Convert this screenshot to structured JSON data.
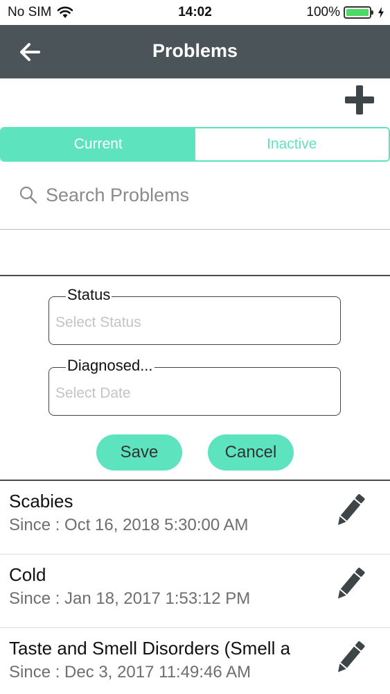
{
  "status_bar": {
    "carrier": "No SIM",
    "time": "14:02",
    "battery": "100%"
  },
  "nav": {
    "title": "Problems",
    "back_icon": "arrow-left-icon"
  },
  "add_icon": "plus-icon",
  "tabs": [
    {
      "label": "Current",
      "active": true
    },
    {
      "label": "Inactive",
      "active": false
    }
  ],
  "search": {
    "placeholder": "Search Problems",
    "value": ""
  },
  "form": {
    "status": {
      "label": "Status",
      "placeholder": "Select Status"
    },
    "diagnosed": {
      "label": "Diagnosed...",
      "placeholder": "Select Date"
    },
    "save_label": "Save",
    "cancel_label": "Cancel"
  },
  "problems": [
    {
      "name": "Scabies",
      "since": "Since : Oct 16, 2018 5:30:00 AM"
    },
    {
      "name": "Cold",
      "since": "Since : Jan 18, 2017 1:53:12 PM"
    },
    {
      "name": "Taste and Smell Disorders (Smell a",
      "since": "Since : Dec 3, 2017 11:49:46 AM"
    }
  ],
  "colors": {
    "accent": "#5ee3bf",
    "nav_bg": "#4b5458",
    "battery": "#4cd964"
  }
}
